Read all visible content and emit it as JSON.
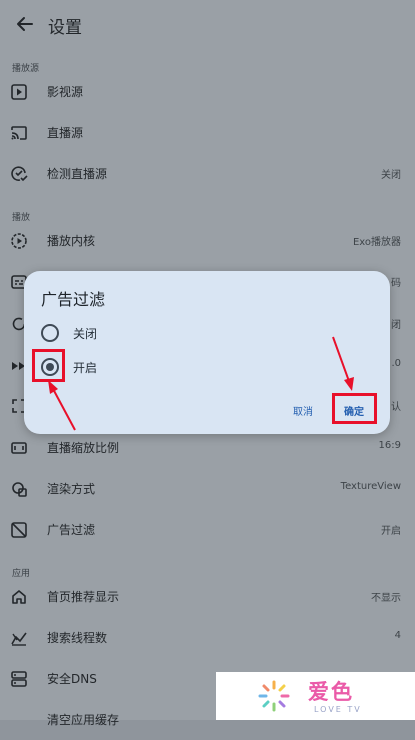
{
  "header": {
    "title": "设置",
    "back_icon": "arrow-left-icon"
  },
  "sections": {
    "source": "播放源",
    "playback": "播放",
    "app": "应用"
  },
  "rows": {
    "vod_source": {
      "label": "影视源",
      "icon": "play-square-icon"
    },
    "live_source": {
      "label": "直播源",
      "icon": "cast-icon"
    },
    "check_live": {
      "label": "检测直播源",
      "value": "关闭",
      "icon": "check-refresh-icon"
    },
    "player_core": {
      "label": "播放内核",
      "value": "Exo播放器",
      "icon": "play-circle-icon"
    },
    "row_decode": {
      "label": "",
      "value": "码",
      "icon": "subtitles-icon"
    },
    "row_loop": {
      "label": "",
      "value": "闭",
      "icon": "refresh-icon"
    },
    "row_speed": {
      "label": "",
      "value": ".0",
      "icon": "fast-forward-icon"
    },
    "row_fullscreen": {
      "label": "",
      "value": "认",
      "icon": "fullscreen-icon"
    },
    "scale": {
      "label": "直播缩放比例",
      "value": "16:9",
      "icon": "aspect-ratio-icon"
    },
    "render": {
      "label": "渲染方式",
      "value": "TextureView",
      "icon": "render-icon"
    },
    "ad_filter": {
      "label": "广告过滤",
      "value": "开启",
      "icon": "ad-block-icon"
    },
    "home_rec": {
      "label": "首页推荐显示",
      "value": "不显示",
      "icon": "home-icon"
    },
    "search_threads": {
      "label": "搜索线程数",
      "value": "4",
      "icon": "thread-chart-icon"
    },
    "dns": {
      "label": "安全DNS",
      "icon": "dns-icon"
    },
    "cut_row": {
      "label": "清空应用缓存"
    }
  },
  "dialog": {
    "title": "广告过滤",
    "options": [
      {
        "label": "关闭",
        "selected": false
      },
      {
        "label": "开启",
        "selected": true
      }
    ],
    "cancel": "取消",
    "confirm": "确定"
  },
  "annotation_color": "#e8102a",
  "watermark": {
    "text": "爱色",
    "sub": "LOVE TV"
  }
}
